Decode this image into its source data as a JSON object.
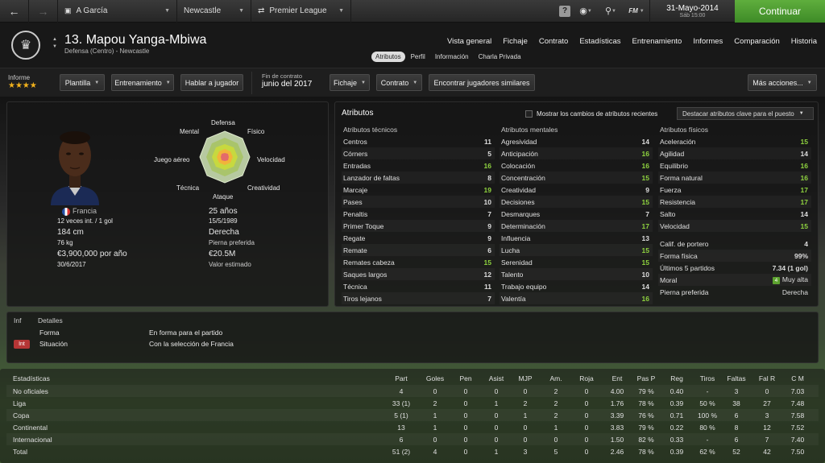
{
  "topbar": {
    "manager": "A García",
    "club": "Newcastle",
    "competition": "Premier League",
    "help": "?",
    "fm_label": "FM",
    "date": "31-Mayo-2014",
    "day_time": "Sáb 15:00",
    "continue_label": "Continuar"
  },
  "player": {
    "number_name": "13. Mapou Yanga-Mbiwa",
    "position_club": "Defensa (Centro) - Newcastle"
  },
  "nav": {
    "tabs": [
      "Vista general",
      "Fichaje",
      "Contrato",
      "Estadísticas",
      "Entrenamiento",
      "Informes",
      "Comparación",
      "Historia"
    ],
    "subtabs": [
      "Atributos",
      "Perfil",
      "Información",
      "Charla Privada"
    ]
  },
  "toolbar": {
    "informe_label": "Informe",
    "stars": "★★★★",
    "plantilla": "Plantilla",
    "entrenamiento": "Entrenamiento",
    "hablar": "Hablar a jugador",
    "contract_label": "Fin de contrato",
    "contract_value": "junio del 2017",
    "fichaje": "Fichaje",
    "contrato": "Contrato",
    "similares": "Encontrar jugadores similares",
    "mas": "Más acciones..."
  },
  "profile": {
    "radar_labels": {
      "defensa": "Defensa",
      "fisico": "Físico",
      "velocidad": "Velocidad",
      "creatividad": "Creatividad",
      "ataque": "Ataque",
      "tecnica": "Técnica",
      "juego_aereo": "Juego aéreo",
      "mental": "Mental"
    },
    "nation": "Francia",
    "caps": "12 veces int. / 1 gol",
    "height": "184 cm",
    "weight": "76 kg",
    "wage": "€3,900,000 por año",
    "contract_end": "30/6/2017",
    "age": "25 años",
    "dob": "15/5/1989",
    "foot": "Derecha",
    "foot_label": "Pierna preferida",
    "value": "€20.5M",
    "value_label": "Valor estimado"
  },
  "attributes": {
    "title": "Atributos",
    "show_changes": "Mostrar los cambios de atributos recientes",
    "highlight": "Destacar atributos clave para el puesto",
    "tech_title": "Atributos técnicos",
    "mental_title": "Atributos mentales",
    "phys_title": "Atributos físicos",
    "tecnicos": [
      {
        "name": "Centros",
        "value": "11"
      },
      {
        "name": "Córners",
        "value": "5"
      },
      {
        "name": "Entradas",
        "value": "16"
      },
      {
        "name": "Lanzador de faltas",
        "value": "8"
      },
      {
        "name": "Marcaje",
        "value": "19"
      },
      {
        "name": "Pases",
        "value": "10"
      },
      {
        "name": "Penaltis",
        "value": "7"
      },
      {
        "name": "Primer Toque",
        "value": "9"
      },
      {
        "name": "Regate",
        "value": "9"
      },
      {
        "name": "Remate",
        "value": "6"
      },
      {
        "name": "Remates cabeza",
        "value": "15"
      },
      {
        "name": "Saques largos",
        "value": "12"
      },
      {
        "name": "Técnica",
        "value": "11"
      },
      {
        "name": "Tiros lejanos",
        "value": "7"
      }
    ],
    "mentales": [
      {
        "name": "Agresividad",
        "value": "14"
      },
      {
        "name": "Anticipación",
        "value": "16"
      },
      {
        "name": "Colocación",
        "value": "16"
      },
      {
        "name": "Concentración",
        "value": "15"
      },
      {
        "name": "Creatividad",
        "value": "9"
      },
      {
        "name": "Decisiones",
        "value": "15"
      },
      {
        "name": "Desmarques",
        "value": "7"
      },
      {
        "name": "Determinación",
        "value": "17"
      },
      {
        "name": "Influencia",
        "value": "13"
      },
      {
        "name": "Lucha",
        "value": "15"
      },
      {
        "name": "Serenidad",
        "value": "15"
      },
      {
        "name": "Talento",
        "value": "10"
      },
      {
        "name": "Trabajo equipo",
        "value": "14"
      },
      {
        "name": "Valentía",
        "value": "16"
      }
    ],
    "fisicos": [
      {
        "name": "Aceleración",
        "value": "15"
      },
      {
        "name": "Agilidad",
        "value": "14"
      },
      {
        "name": "Equilibrio",
        "value": "16"
      },
      {
        "name": "Forma natural",
        "value": "16"
      },
      {
        "name": "Fuerza",
        "value": "17"
      },
      {
        "name": "Resistencia",
        "value": "17"
      },
      {
        "name": "Salto",
        "value": "14"
      },
      {
        "name": "Velocidad",
        "value": "15"
      }
    ],
    "extra": [
      {
        "name": "Calif. de portero",
        "value": "4"
      },
      {
        "name": "Forma física",
        "value": "99%"
      },
      {
        "name": "Últimos 5 partidos",
        "value": "7.34 (1 gol)"
      },
      {
        "name": "Moral",
        "value": "Muy alta",
        "badge": "4"
      },
      {
        "name": "Pierna preferida",
        "value": "Derecha"
      }
    ]
  },
  "details": {
    "inf_label": "Inf",
    "details_label": "Detalles",
    "forma_label": "Forma",
    "forma_value": "En forma para el partido",
    "int_tag": "Int",
    "situacion_label": "Situación",
    "situacion_value": "Con la selección de Francia"
  },
  "stats": {
    "title": "Estadísticas",
    "headers": [
      "Part",
      "Goles",
      "Pen",
      "Asist",
      "MJP",
      "Am.",
      "Roja",
      "Ent",
      "Pas P",
      "Reg",
      "Tiros",
      "Faltas",
      "Fal R",
      "C M"
    ],
    "rows": [
      {
        "label": "No oficiales",
        "cells": [
          "4",
          "0",
          "0",
          "0",
          "0",
          "2",
          "0",
          "4.00",
          "79 %",
          "0.40",
          "-",
          "3",
          "0",
          "7.03"
        ]
      },
      {
        "label": "Liga",
        "cells": [
          "33 (1)",
          "2",
          "0",
          "1",
          "2",
          "2",
          "0",
          "1.76",
          "78 %",
          "0.39",
          "50 %",
          "38",
          "27",
          "7.48"
        ]
      },
      {
        "label": "Copa",
        "cells": [
          "5 (1)",
          "1",
          "0",
          "0",
          "1",
          "2",
          "0",
          "3.39",
          "76 %",
          "0.71",
          "100 %",
          "6",
          "3",
          "7.58"
        ]
      },
      {
        "label": "Continental",
        "cells": [
          "13",
          "1",
          "0",
          "0",
          "0",
          "1",
          "0",
          "3.83",
          "79 %",
          "0.22",
          "80 %",
          "8",
          "12",
          "7.52"
        ]
      },
      {
        "label": "Internacional",
        "cells": [
          "6",
          "0",
          "0",
          "0",
          "0",
          "0",
          "0",
          "1.50",
          "82 %",
          "0.33",
          "-",
          "6",
          "7",
          "7.40"
        ]
      },
      {
        "label": "Total",
        "cells": [
          "51 (2)",
          "4",
          "0",
          "1",
          "3",
          "5",
          "0",
          "2.46",
          "78 %",
          "0.39",
          "62 %",
          "52",
          "42",
          "7.50"
        ]
      }
    ]
  }
}
